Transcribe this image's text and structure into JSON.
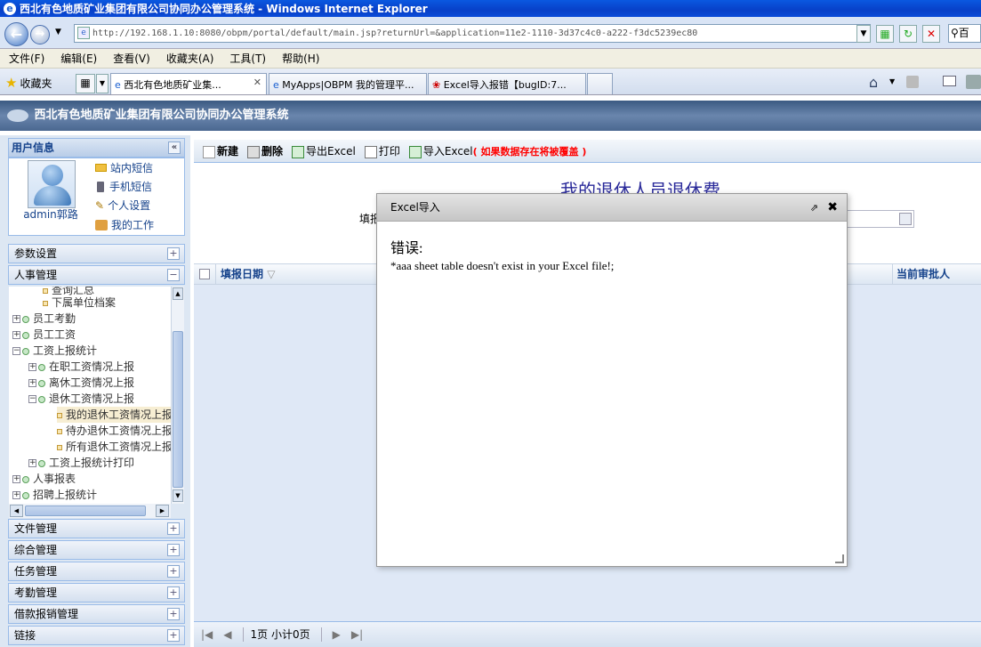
{
  "window": {
    "title": "西北有色地质矿业集团有限公司协同办公管理系统 - Windows Internet Explorer"
  },
  "browser": {
    "address": "http://192.168.1.10:8080/obpm/portal/default/main.jsp?returnUrl=&application=11e2-1110-3d37c4c0-a222-f3dc5239ec80",
    "search_placeholder": "百",
    "menu": [
      "文件(F)",
      "编辑(E)",
      "查看(V)",
      "收藏夹(A)",
      "工具(T)",
      "帮助(H)"
    ],
    "favorites_label": "收藏夹",
    "tabs": [
      {
        "label": "西北有色地质矿业集..."
      },
      {
        "label": "MyApps|OBPM 我的管理平..."
      },
      {
        "label": "Excel导入报错【bugID:7..."
      }
    ]
  },
  "app": {
    "title": "西北有色地质矿业集团有限公司协同办公管理系统"
  },
  "user_panel": {
    "title": "用户信息",
    "username": "admin郭路",
    "links": [
      "站内短信",
      "手机短信",
      "个人设置",
      "我的工作"
    ]
  },
  "sidebar": {
    "sections": [
      "参数设置",
      "人事管理",
      "文件管理",
      "综合管理",
      "任务管理",
      "考勤管理",
      "借款报销管理",
      "链接"
    ],
    "tree": [
      "查询汇总",
      "下属单位档案",
      "员工考勤",
      "员工工资",
      "工资上报统计",
      "在职工资情况上报",
      "离休工资情况上报",
      "退休工资情况上报",
      "我的退休工资情况上报",
      "待办退休工资情况上报",
      "所有退休工资情况上报",
      "工资上报统计打印",
      "人事报表",
      "招聘上报统计"
    ]
  },
  "toolbar": {
    "new": "新建",
    "delete": "删除",
    "export": "导出Excel",
    "print": "打印",
    "import": "导入Excel",
    "import_warning": "( 如果数据存在将被覆盖 )"
  },
  "form": {
    "title": "我的退休人员退休费",
    "filter_label": "填报"
  },
  "grid": {
    "columns": [
      "填报日期",
      "当前审批人"
    ]
  },
  "pager": {
    "text": "1页 小计0页"
  },
  "dialog": {
    "title": "Excel导入",
    "error_heading": "错误:",
    "error_message": "*aaa sheet table doesn't exist in your Excel file!;"
  },
  "colors": {
    "accent": "#15428b",
    "warning": "#ff0000",
    "header": "#4a6790"
  }
}
